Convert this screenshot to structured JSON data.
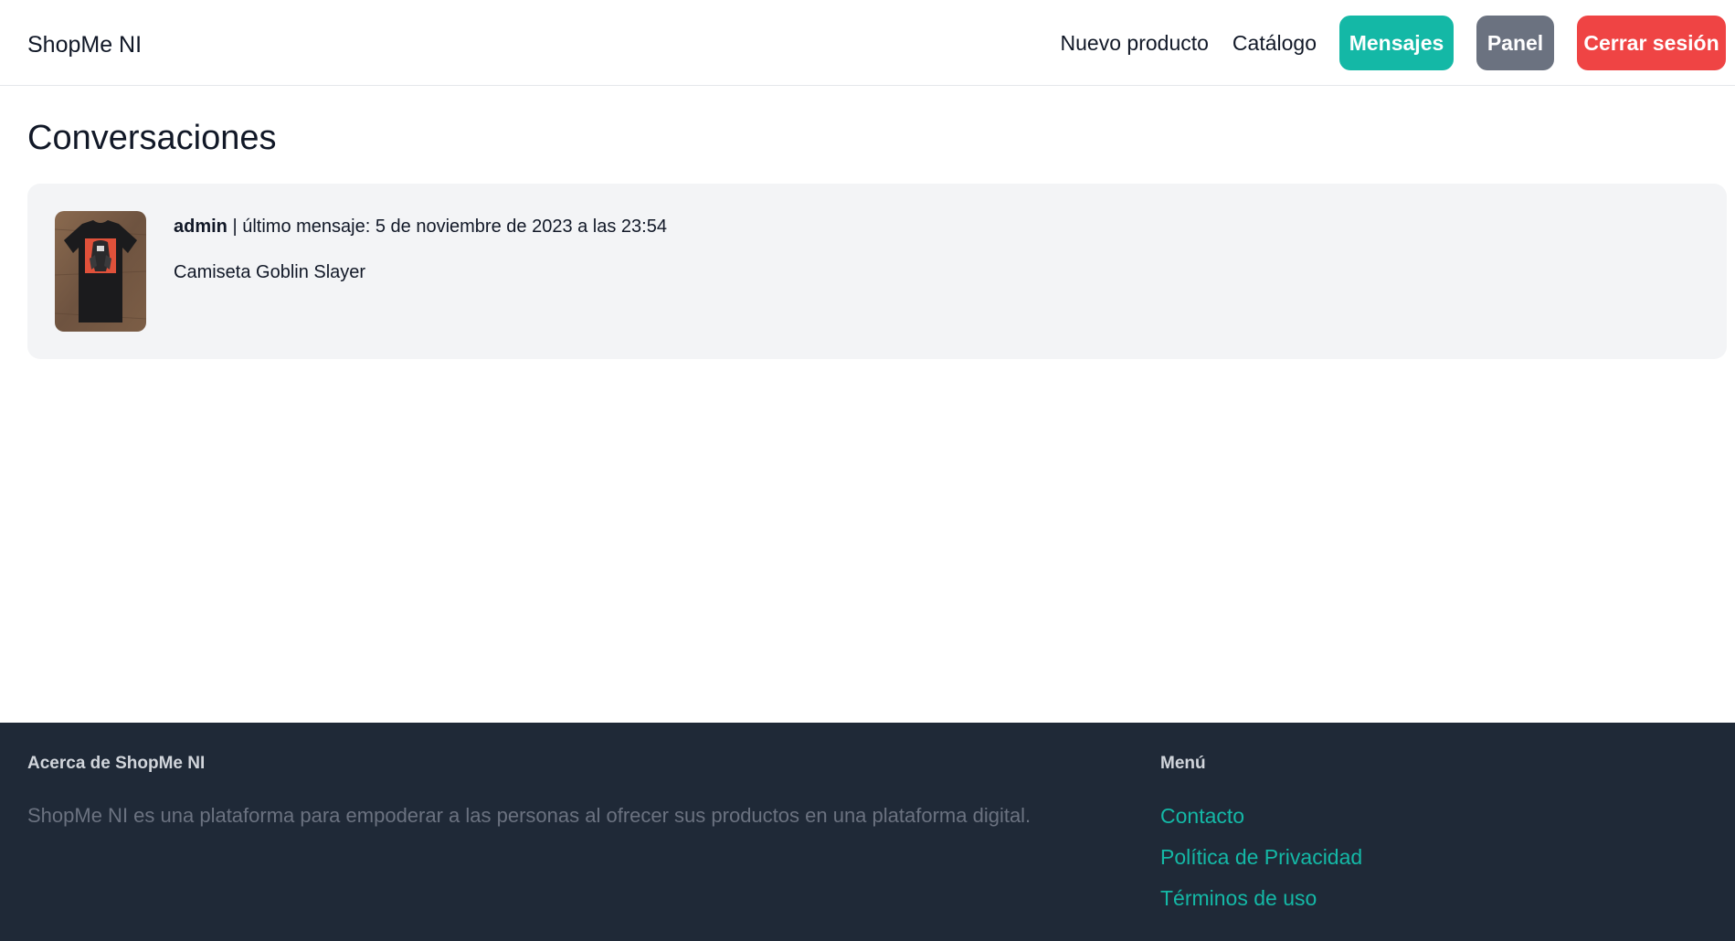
{
  "navbar": {
    "brand": "ShopMe NI",
    "links": {
      "new_product": "Nuevo producto",
      "catalog": "Catálogo"
    },
    "buttons": {
      "messages": "Mensajes",
      "panel": "Panel",
      "logout": "Cerrar sesión"
    }
  },
  "main": {
    "title": "Conversaciones",
    "conversations": [
      {
        "user": "admin",
        "separator": "|",
        "last_message_label": "último mensaje: 5 de noviembre de 2023 a las 23:54",
        "product": "Camiseta Goblin Slayer",
        "thumbnail_icon": "tshirt-product-image"
      }
    ]
  },
  "footer": {
    "about_title": "Acerca de ShopMe NI",
    "about_text": "ShopMe NI es una plataforma para empoderar a las personas al ofrecer sus productos en una plataforma digital.",
    "menu_title": "Menú",
    "menu_links": [
      "Contacto",
      "Política de Privacidad",
      "Términos de uso"
    ]
  },
  "colors": {
    "teal": "#14b8a6",
    "gray_button": "#6b7280",
    "red_button": "#ef4444",
    "card_bg": "#f3f4f6",
    "footer_bg": "#1f2937"
  }
}
